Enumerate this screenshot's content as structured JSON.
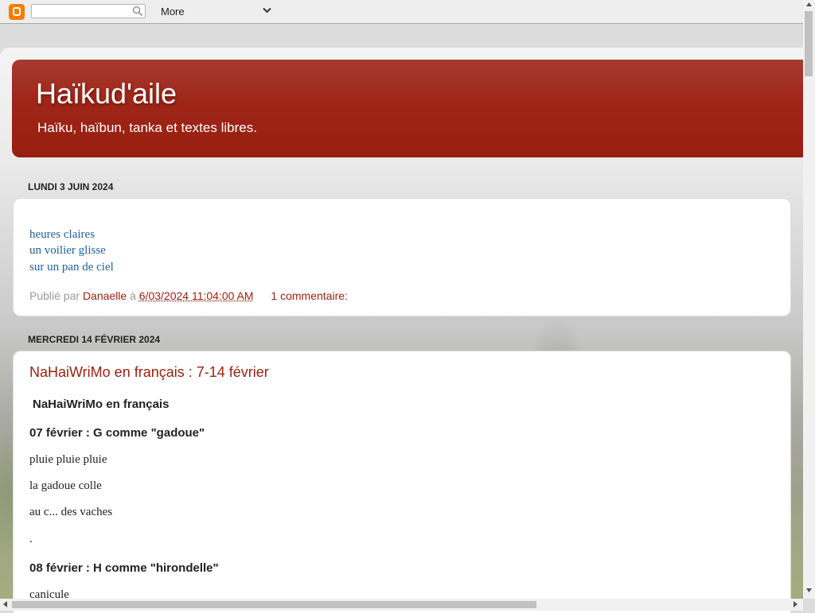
{
  "navbar": {
    "search_value": "",
    "more_label": "More"
  },
  "blog": {
    "title": "Haïkud'aile",
    "description": "Haïku, haïbun, tanka et textes libres."
  },
  "posts": [
    {
      "date": "Lundi 3 juin 2024",
      "lines": [
        "heures claires",
        "un voilier glisse",
        "sur un pan de ciel"
      ],
      "footer": {
        "published_by": "Publié par",
        "author": "Danaelle",
        "at": "à",
        "timestamp": "6/03/2024 11:04:00 AM",
        "comments": "1 commentaire:"
      }
    },
    {
      "date": "Mercredi 14 février 2024",
      "title": "NaHaiWriMo en français : 7-14 février",
      "intro": "NaHaiWriMo en français",
      "section1": "07 février : G comme \"gadoue\"",
      "haiku1": [
        "pluie pluie pluie",
        "la gadoue colle",
        "au c... des vaches",
        "."
      ],
      "section2": "08 février : H comme \"hirondelle\"",
      "haiku2_first": "canicule"
    }
  ],
  "colors": {
    "header_red": "#9e2517",
    "link_blue": "#1f5f9a",
    "accent_red": "#992211"
  }
}
